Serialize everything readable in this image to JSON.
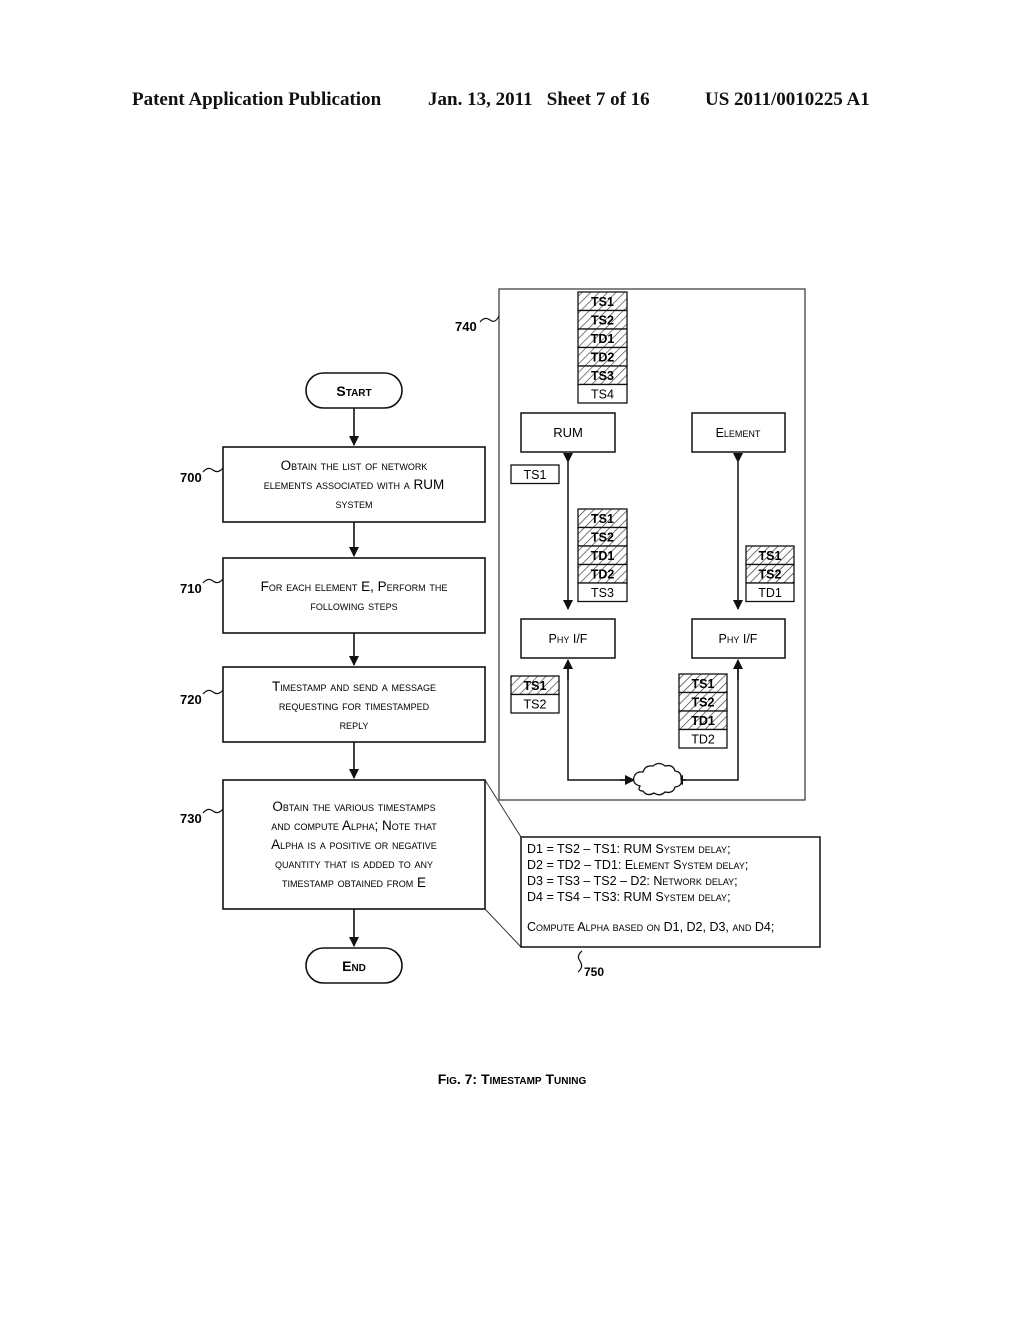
{
  "header": {
    "publication": "Patent Application Publication",
    "date_sheet": "Jan. 13, 2011   Sheet 7 of 16",
    "patent_number": "US 2011/0010225 A1"
  },
  "flowchart": {
    "start": "Start",
    "end": "End",
    "steps": [
      {
        "ref": "700",
        "lines": [
          "Obtain the list of network",
          "elements associated with a RUM",
          "system"
        ]
      },
      {
        "ref": "710",
        "lines": [
          "For each element E, Perform the",
          "following steps"
        ]
      },
      {
        "ref": "720",
        "lines": [
          "Timestamp and send a message",
          "requesting for timestamped",
          "reply"
        ]
      },
      {
        "ref": "730",
        "lines": [
          "Obtain the various timestamps",
          "and compute Alpha; Note that",
          "Alpha is a positive or negative",
          "quantity that is added to any",
          "timestamp obtained from E"
        ]
      }
    ]
  },
  "panel_740": {
    "ref": "740",
    "rum": "RUM",
    "element": "Element",
    "phy_left": "Phy I/F",
    "phy_right": "Phy I/F",
    "stacks": {
      "top": {
        "hatched": [
          "TS1",
          "TS2",
          "TD1",
          "TD2",
          "TS3"
        ],
        "plain": [
          "TS4"
        ]
      },
      "rum_out": {
        "hatched": [],
        "plain": [
          "TS1"
        ]
      },
      "rum_in": {
        "hatched": [
          "TS1",
          "TS2",
          "TD1",
          "TD2"
        ],
        "plain": [
          "TS3"
        ]
      },
      "elem_in": {
        "hatched": [
          "TS1",
          "TS2"
        ],
        "plain": [
          "TD1"
        ]
      },
      "phy_left": {
        "hatched": [
          "TS1"
        ],
        "plain": [
          "TS2"
        ]
      },
      "phy_right": {
        "hatched": [
          "TS1",
          "TS2",
          "TD1"
        ],
        "plain": [
          "TD2"
        ]
      }
    },
    "network_icon": "cloud-icon"
  },
  "panel_750": {
    "ref": "750",
    "lines": [
      "D1 = TS2 – TS1: RUM System delay;",
      "D2 = TD2 – TD1: Element System delay;",
      "D3 = TS3 – TS2 – D2: Network delay;",
      "D4 = TS4 – TS3: RUM System delay;",
      "",
      "Compute Alpha based on D1, D2, D3, and D4;"
    ]
  },
  "caption": "Fig. 7: Timestamp Tuning"
}
